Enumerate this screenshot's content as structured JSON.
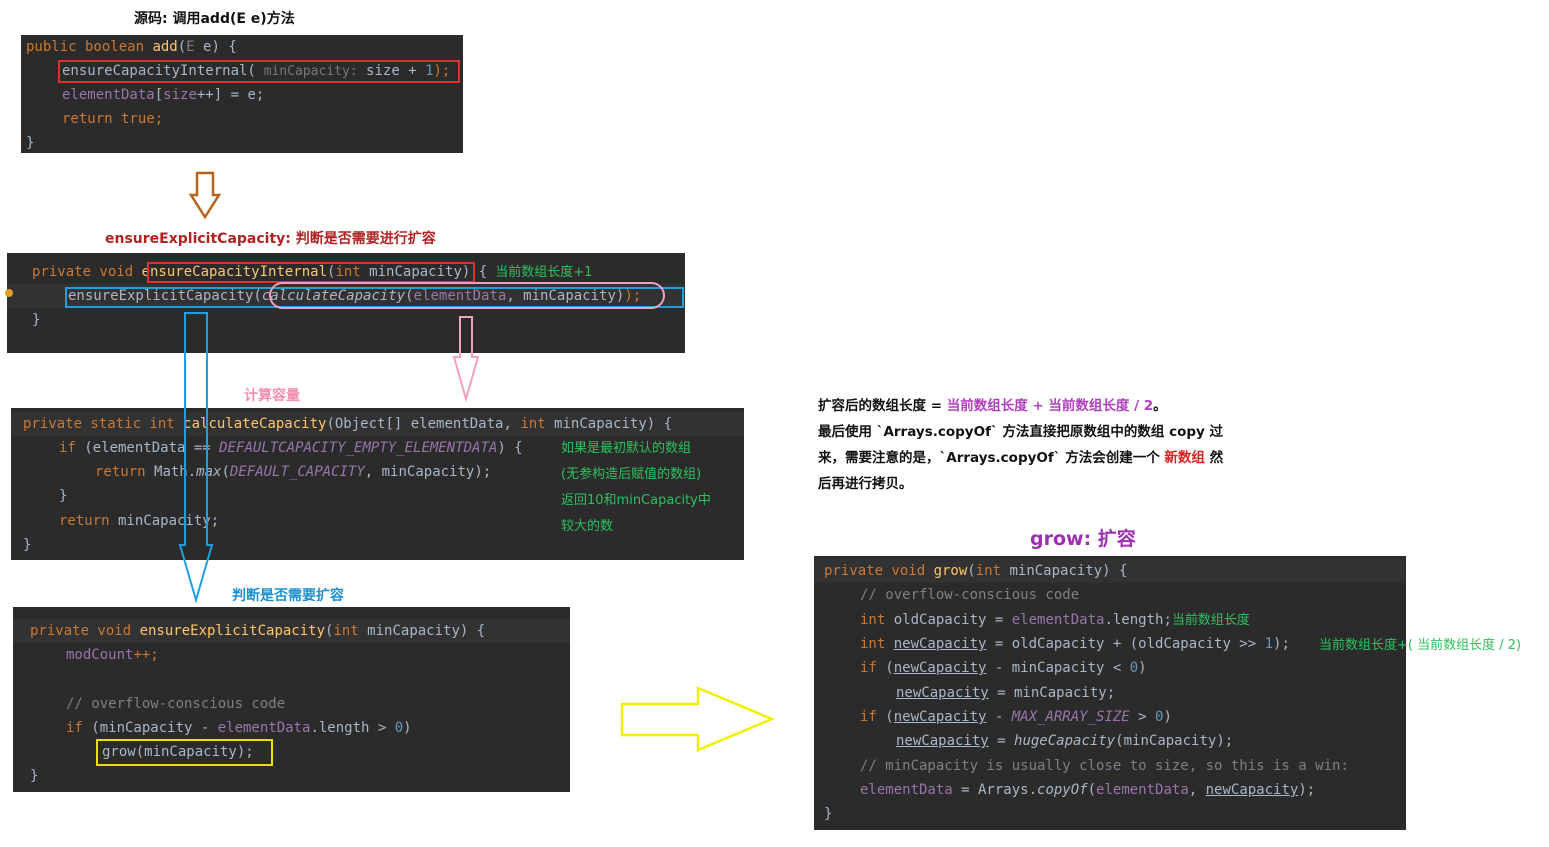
{
  "captions": {
    "source": "源码: 调用add(E e)方法",
    "explicit": "ensureExplicitCapacity: 判断是否需要进行扩容",
    "calc": "计算容量",
    "judge": "判断是否需要扩容",
    "grow": "grow: 扩容"
  },
  "paragraph": {
    "l1a": "扩容后的数组长度 = ",
    "l1b": "当前数组长度 + 当前数组长度 / 2",
    "l1c": "。",
    "l2": "最后使用 `Arrays.copyOf` 方法直接把原数组中的数组 copy 过",
    "l3a": "来，需要注意的是，`Arrays.copyOf` 方法会创建一个 ",
    "l3b": "新数组",
    "l3c": " 然",
    "l4": "后再进行拷贝。"
  },
  "add_code": {
    "l1_kw": "public boolean ",
    "l1_fn": "add",
    "l1_p": "(",
    "l1_t": "E",
    "l1_r": " e) {",
    "l2_call": "ensureCapacityInternal(",
    "l2_hint": " minCapacity:",
    "l2_rest": " size + ",
    "l2_num": "1",
    "l2_end": ");",
    "l3_fd": "elementData",
    "l3_a": "[",
    "l3_fd2": "size",
    "l3_b": "++] = e;",
    "l4_kw": "return true;",
    "l5": "}"
  },
  "internal_code": {
    "l1_kw": "private void ",
    "l1_fn": "ensureCapacityInternal",
    "l1_p": "(",
    "l1_kw2": "int",
    "l1_r": " minCapacity) {",
    "l1_note": "当前数组长度+1",
    "l2_call": "ensureExplicitCapacity(",
    "l2_it": "calculateCapacity",
    "l2_p": "(",
    "l2_fd": "elementData",
    "l2_r": ", minCapacity)",
    "l2_end": ");",
    "l3": "}"
  },
  "calc_code": {
    "l1_kw": "private static int ",
    "l1_fn": "calculateCapacity",
    "l1_r": "(Object[] elementData, ",
    "l1_kw2": "int",
    "l1_r2": " minCapacity) {",
    "l2_kw": "if",
    "l2_a": " (elementData == ",
    "l2_fd": "DEFAULTCAPACITY_EMPTY_ELEMENTDATA",
    "l2_b": ") {",
    "l3_kw": "return ",
    "l3_a": "Math.",
    "l3_it": "max",
    "l3_b": "(",
    "l3_fd": "DEFAULT_CAPACITY",
    "l3_c": ", minCapacity);",
    "l4": "}",
    "l5_kw": "return",
    "l5_a": " minCapacity;",
    "l6": "}",
    "notes": [
      "如果是最初默认的数组",
      "(无参构造后赋值的数组)",
      "返回10和minCapacity中",
      "较大的数"
    ]
  },
  "explicit_code": {
    "l1_kw": "private void ",
    "l1_fn": "ensureExplicitCapacity",
    "l1_p": "(",
    "l1_kw2": "int",
    "l1_r": " minCapacity) {",
    "l2_fd": "modCount",
    "l2_r": "++;",
    "l4_cm": "// overflow-conscious code",
    "l5_kw": "if",
    "l5_a": " (minCapacity - ",
    "l5_fd": "elementData",
    "l5_b": ".length > ",
    "l5_num": "0",
    "l5_c": ")",
    "l6": "grow(minCapacity);",
    "l7": "}"
  },
  "grow_code": {
    "l1_kw": "private void ",
    "l1_fn": "grow",
    "l1_p": "(",
    "l1_kw2": "int",
    "l1_r": " minCapacity) {",
    "l2_cm": "// overflow-conscious code",
    "l3_kw": "int",
    "l3_a": " oldCapacity = ",
    "l3_fd": "elementData",
    "l3_b": ".length;",
    "l3_note": "当前数组长度",
    "l4_kw": "int ",
    "l4_ul": "newCapacity",
    "l4_a": " = oldCapacity + (oldCapacity >> ",
    "l4_num": "1",
    "l4_b": ");",
    "l4_note": "当前数组长度+( 当前数组长度 / 2)",
    "l5_kw": "if",
    "l5_a": " (",
    "l5_ul": "newCapacity",
    "l5_b": " - minCapacity < ",
    "l5_num": "0",
    "l5_c": ")",
    "l6_ul": "newCapacity",
    "l6_a": " = minCapacity;",
    "l7_kw": "if",
    "l7_a": " (",
    "l7_ul": "newCapacity",
    "l7_b": " - ",
    "l7_fd": "MAX_ARRAY_SIZE",
    "l7_c": " > ",
    "l7_num": "0",
    "l7_d": ")",
    "l8_ul": "newCapacity",
    "l8_a": " = ",
    "l8_it": "hugeCapacity",
    "l8_b": "(minCapacity);",
    "l9_cm": "// minCapacity is usually close to size, so this is a win:",
    "l10_fd": "elementData",
    "l10_a": " = Arrays.",
    "l10_it": "copyOf",
    "l10_b": "(",
    "l10_fd2": "elementData",
    "l10_c": ", ",
    "l10_ul": "newCapacity",
    "l10_d": ");",
    "l11": "}"
  },
  "colors": {
    "caption_black": "#111111",
    "caption_red": "#b22222",
    "caption_pink": "#f090b0",
    "caption_blue": "#1e90d0",
    "caption_purple": "#9b30b0",
    "arrow_brown": "#b5651d",
    "arrow_blue": "#1ea0e0",
    "arrow_pink": "#f0a0c0",
    "arrow_yellow": "#f0f000"
  }
}
